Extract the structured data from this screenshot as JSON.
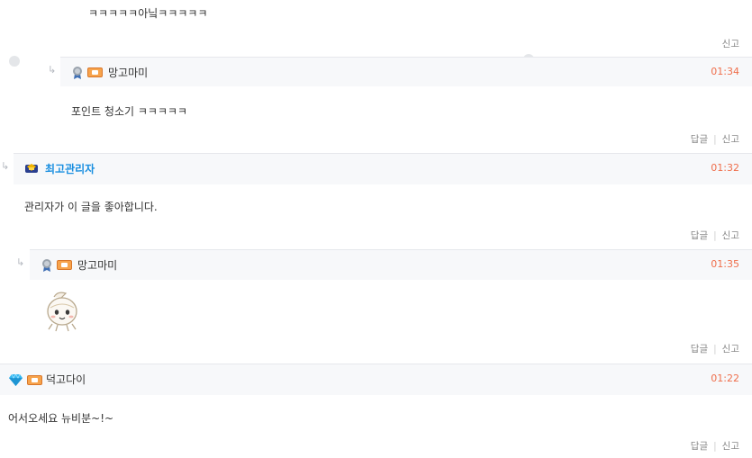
{
  "comments": [
    {
      "body": "ㅋㅋㅋㅋㅋ아닠ㅋㅋㅋㅋㅋ",
      "actions": {
        "report": "신고"
      }
    },
    {
      "nickname": "망고마미",
      "time": "01:34",
      "body": "포인트 청소기 ㅋㅋㅋㅋㅋ",
      "actions": {
        "reply": "답글",
        "report": "신고"
      }
    },
    {
      "nickname": "최고관리자",
      "time": "01:32",
      "body": "관리자가 이 글을 좋아합니다.",
      "actions": {
        "reply": "답글",
        "report": "신고"
      }
    },
    {
      "nickname": "망고마미",
      "time": "01:35",
      "actions": {
        "reply": "답글",
        "report": "신고"
      }
    },
    {
      "nickname": "덕고다이",
      "time": "01:22",
      "body": "어서오세요 뉴비분~!~",
      "actions": {
        "reply": "답글",
        "report": "신고"
      }
    }
  ],
  "icons": {
    "reply_arrow": "reply-arrow-icon",
    "medal": "medal-icon",
    "level_badge": "level-badge-icon",
    "admin_badge": "admin-badge-icon",
    "diamond": "diamond-icon",
    "emoticon": "emoticon-character"
  },
  "colors": {
    "time": "#ef6e4b",
    "admin_name": "#1a8fe0",
    "header_bg": "#f7f8fa"
  }
}
